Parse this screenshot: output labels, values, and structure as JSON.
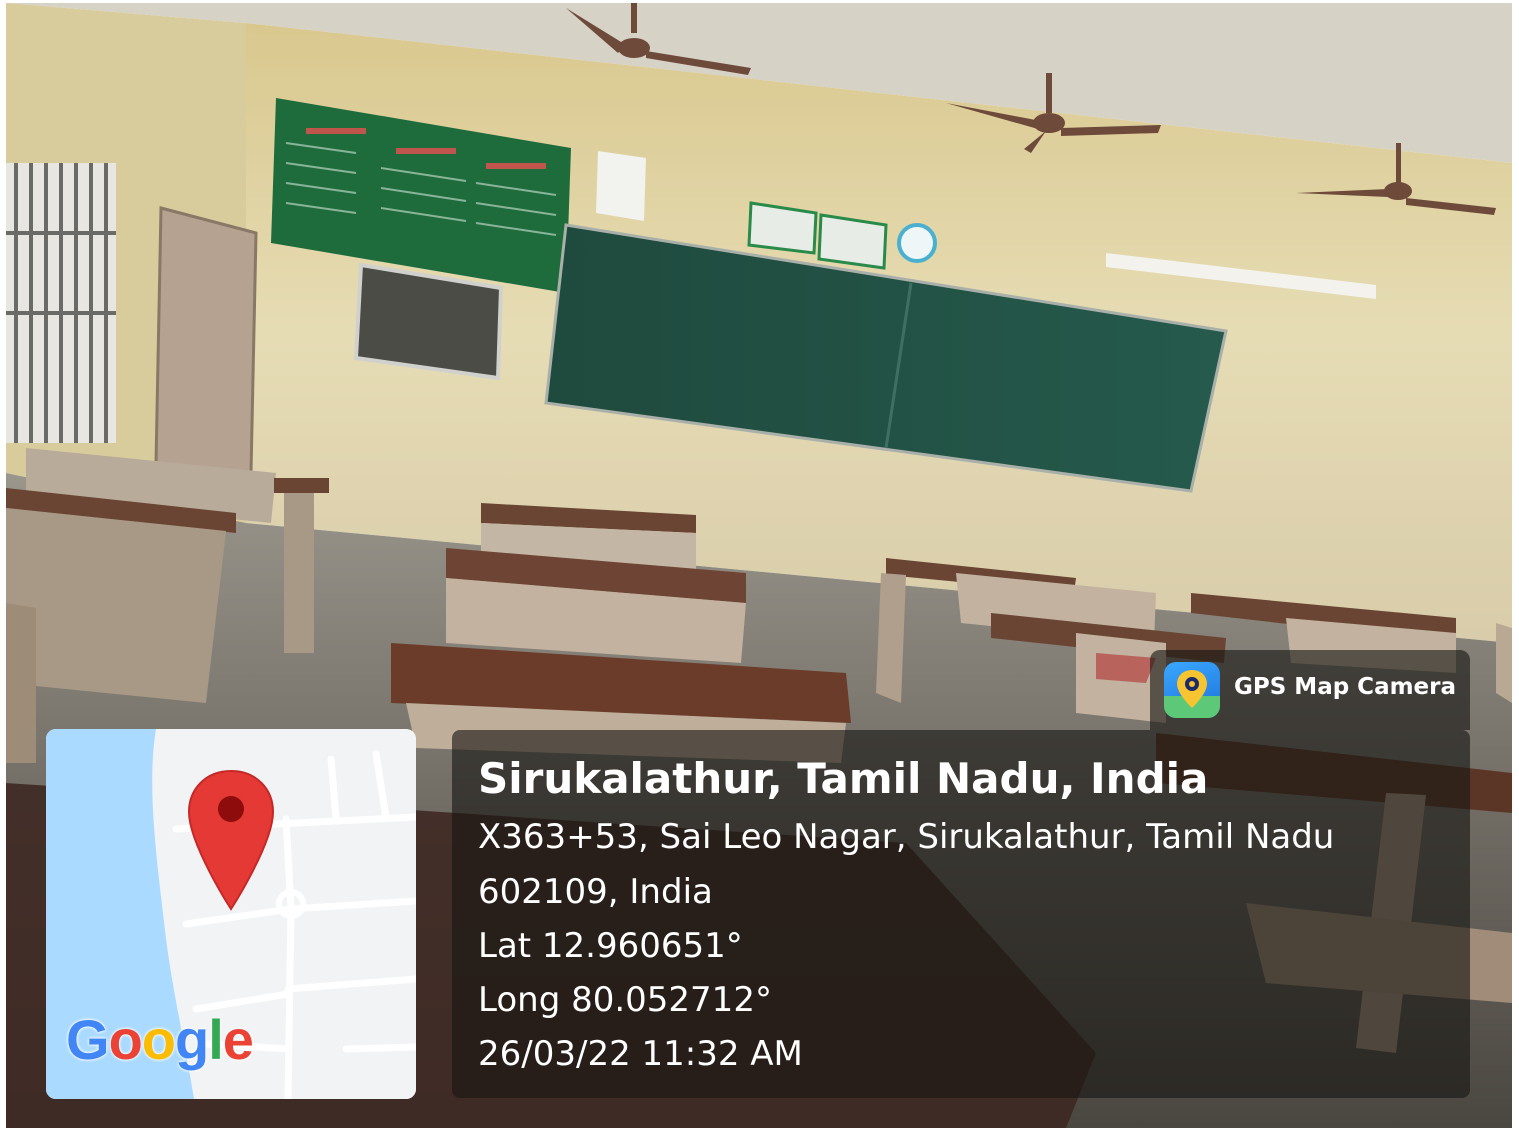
{
  "watermark": {
    "app_label": "GPS Map Camera",
    "place_title": "Sirukalathur, Tamil Nadu, India",
    "address_line1": "X363+53, Sai Leo Nagar, Sirukalathur, Tamil Nadu",
    "address_line2": "602109, India",
    "latitude": "Lat 12.960651°",
    "longitude": "Long 80.052712°",
    "timestamp": "26/03/22 11:32 AM"
  },
  "map": {
    "logo_text": "Google",
    "logo_letters": [
      "G",
      "o",
      "o",
      "g",
      "l",
      "e"
    ],
    "logo_colors": [
      "#4285F4",
      "#EA4335",
      "#FBBC05",
      "#4285F4",
      "#34A853",
      "#EA4335"
    ],
    "water_color": "#aadaff",
    "pin_color": "#e53935"
  },
  "icons": {
    "map_pin": "map-pin-icon",
    "app_icon": "gps-map-camera-icon"
  }
}
